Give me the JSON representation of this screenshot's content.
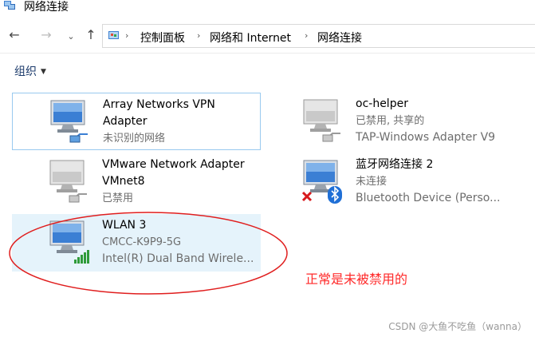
{
  "window": {
    "title": "网络连接"
  },
  "nav": {
    "breadcrumb": [
      "控制面板",
      "网络和 Internet",
      "网络连接"
    ]
  },
  "toolbar": {
    "organize_label": "组织"
  },
  "connections": [
    {
      "name_line1": "Array Networks VPN",
      "name_line2": "Adapter",
      "status": "未识别的网络",
      "device": "",
      "state": "focused"
    },
    {
      "name_line1": "oc-helper",
      "name_line2": "",
      "status": "已禁用, 共享的",
      "device": "TAP-Windows Adapter V9",
      "state": "disabled"
    },
    {
      "name_line1": "VMware Network Adapter",
      "name_line2": "VMnet8",
      "status": "已禁用",
      "device": "",
      "state": "disabled"
    },
    {
      "name_line1": "蓝牙网络连接 2",
      "name_line2": "",
      "status": "未连接",
      "device": "Bluetooth Device (Perso...",
      "state": "disconnected"
    },
    {
      "name_line1": "WLAN 3",
      "name_line2": "",
      "status": "CMCC-K9P9-5G",
      "device": "Intel(R) Dual Band Wirele...",
      "state": "selected"
    }
  ],
  "annotation": {
    "note": "正常是未被禁用的",
    "color": "#ff2a2a"
  },
  "watermark": "CSDN @大鱼不吃鱼（wanna）",
  "colors": {
    "accent": "#1b3a6b",
    "selection": "#e5f3fb",
    "focus_border": "#99c9ef"
  }
}
